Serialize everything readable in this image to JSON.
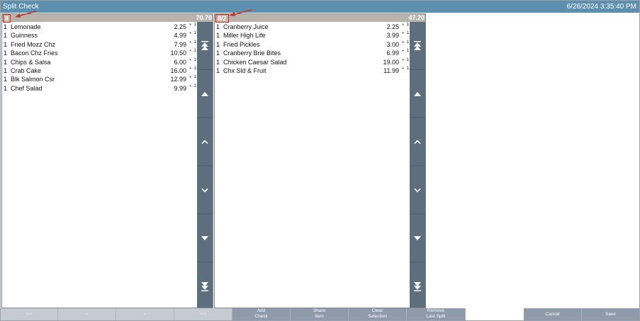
{
  "window": {
    "title": "Split Check",
    "datetime": "6/26/2024 3:35:40 PM"
  },
  "checks": [
    {
      "id": "8",
      "total": "70.70",
      "items": [
        {
          "qty": "1",
          "name": "Lemonade",
          "price": "2.25",
          "mark": "*",
          "seat": "1"
        },
        {
          "qty": "1",
          "name": "Guinness",
          "price": "4.99",
          "mark": "*",
          "seat": "1"
        },
        {
          "qty": "1",
          "name": "Fried Mozz Chz",
          "price": "7.99",
          "mark": "*",
          "seat": "1"
        },
        {
          "qty": "1",
          "name": "Bacon Chz Fries",
          "price": "10.50",
          "mark": "*",
          "seat": "1"
        },
        {
          "qty": "1",
          "name": "Chips & Salsa",
          "price": "6.00",
          "mark": "*",
          "seat": "1"
        },
        {
          "qty": "1",
          "name": "Crab Cake",
          "price": "16.00",
          "mark": "*",
          "seat": "1"
        },
        {
          "qty": "1",
          "name": "Blk Salmon Csr",
          "price": "12.99",
          "mark": "*",
          "seat": "1"
        },
        {
          "qty": "1",
          "name": "Chef Salad",
          "price": "9.99",
          "mark": "*",
          "seat": "1"
        }
      ]
    },
    {
      "id": "8/2",
      "total": "47.20",
      "items": [
        {
          "qty": "1",
          "name": "Cranberry Juice",
          "price": "2.25",
          "mark": "*",
          "seat": "1"
        },
        {
          "qty": "1",
          "name": "Miller High Life",
          "price": "3.99",
          "mark": "*",
          "seat": "1"
        },
        {
          "qty": "1",
          "name": "Fried Pickles",
          "price": "3.00",
          "mark": "*",
          "seat": "1"
        },
        {
          "qty": "1",
          "name": "Cranberry Brie Bites",
          "price": "6.99",
          "mark": "*",
          "seat": "1"
        },
        {
          "qty": "1",
          "name": "Chicken Caesar Salad",
          "price": "19.00",
          "mark": "*",
          "seat": "1"
        },
        {
          "qty": "1",
          "name": "Chx Sld & Fruit",
          "price": "11.99",
          "mark": "*",
          "seat": "1"
        }
      ]
    }
  ],
  "scroll_icons": [
    "double-chevron-up-icon",
    "triangle-up-icon",
    "chevron-up-icon",
    "chevron-down-icon",
    "triangle-down-icon",
    "double-chevron-down-icon"
  ],
  "nav": {
    "first": "|<<",
    "prev": "<",
    "next": ">",
    "last": ">>|"
  },
  "actions": {
    "add_check": [
      "Add",
      "Check"
    ],
    "share_item": [
      "Share",
      "Item"
    ],
    "clear_selection": [
      "Clear",
      "Selection"
    ],
    "remove_last_split": [
      "Remove",
      "Last Split"
    ],
    "cancel": "Cancel",
    "save": "Save"
  },
  "colors": {
    "titlebar": "#5d8fae",
    "scrollbar": "#5d6e7d",
    "button": "#8f9aab",
    "header": "#b9b3ae",
    "annotation": "#c0392b"
  }
}
